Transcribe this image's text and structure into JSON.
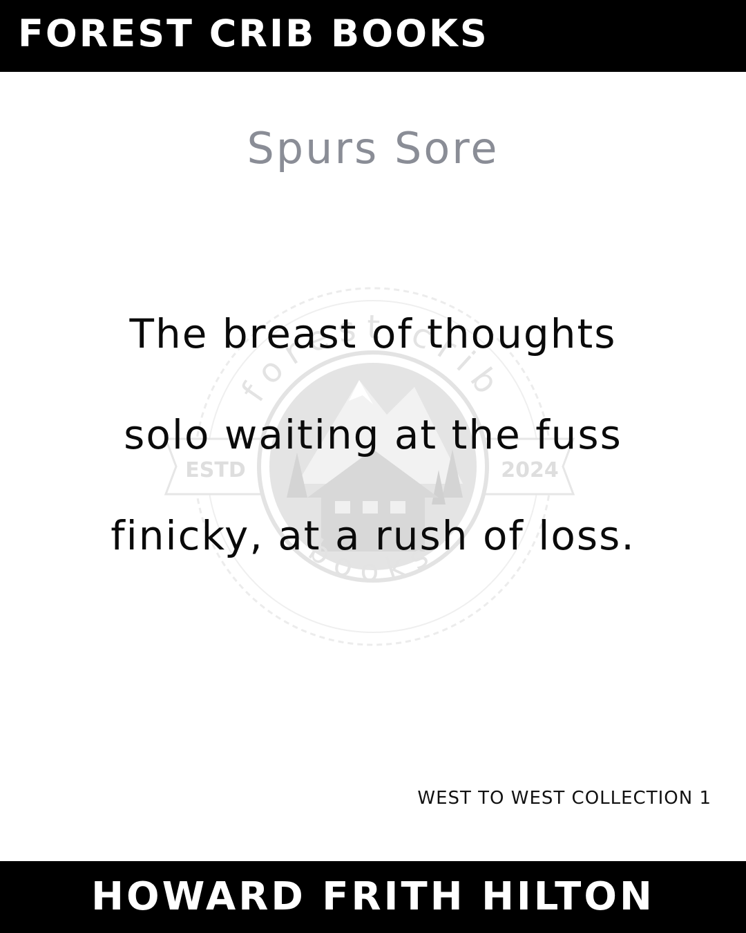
{
  "header": {
    "publisher": "FOREST CRIB BOOKS"
  },
  "poem": {
    "title": "Spurs Sore",
    "lines": [
      "The breast of thoughts",
      "solo waiting at the fuss",
      "finicky, at a rush of loss."
    ]
  },
  "collection": "WEST TO WEST COLLECTION 1",
  "footer": {
    "author": "HOWARD FRITH HILTON"
  },
  "watermark": {
    "text_top": "forest crib",
    "text_bottom": "books",
    "left": "ESTD",
    "right": "2024"
  },
  "colors": {
    "bar": "#000000",
    "title": "#8a8d96",
    "text": "#0a0a0a",
    "watermark": "#e1e1e1",
    "background": "#ffffff"
  },
  "icons": {
    "watermark": "forest-crib-logo-icon"
  }
}
